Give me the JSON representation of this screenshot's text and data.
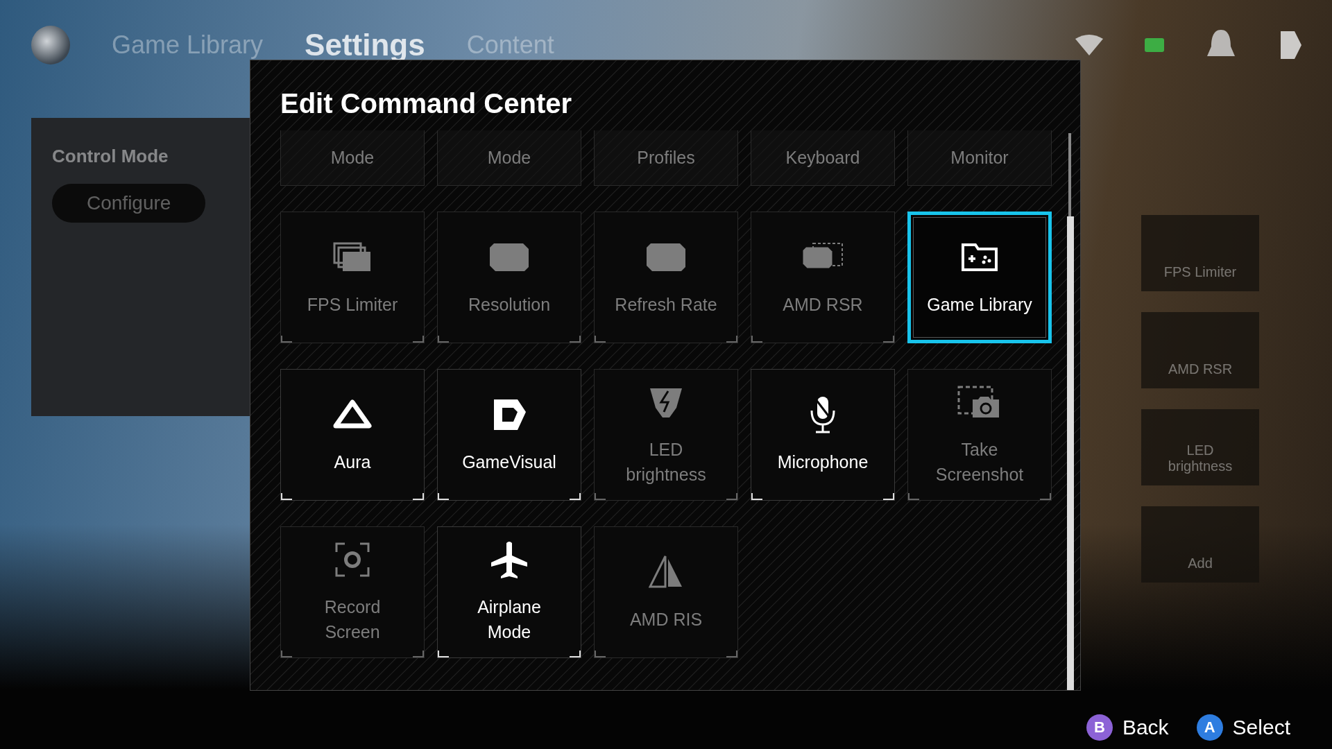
{
  "nav": {
    "tabs": [
      {
        "label": "Game Library",
        "selected": false
      },
      {
        "label": "Settings",
        "selected": true
      },
      {
        "label": "Content",
        "selected": false
      }
    ]
  },
  "background_panel": {
    "title": "Control Mode",
    "button": "Configure"
  },
  "background_tiles": [
    {
      "label": "FPS Limiter"
    },
    {
      "label": "AMD RSR"
    },
    {
      "label": "LED\nbrightness"
    },
    {
      "label": "Add"
    }
  ],
  "dialog": {
    "title": "Edit Command Center",
    "tiles": [
      {
        "label": "Mode",
        "kind": "partial",
        "active": false,
        "selected": false
      },
      {
        "label": "Mode",
        "kind": "partial",
        "active": false,
        "selected": false
      },
      {
        "label": "Profiles",
        "kind": "partial",
        "active": false,
        "selected": false
      },
      {
        "label": "Keyboard",
        "kind": "partial",
        "active": false,
        "selected": false
      },
      {
        "label": "Monitor",
        "kind": "partial",
        "active": false,
        "selected": false
      },
      {
        "label": "FPS Limiter",
        "kind": "full",
        "active": false,
        "selected": false
      },
      {
        "label": "Resolution",
        "kind": "full",
        "active": false,
        "selected": false
      },
      {
        "label": "Refresh Rate",
        "kind": "full",
        "active": false,
        "selected": false
      },
      {
        "label": "AMD RSR",
        "kind": "full",
        "active": false,
        "selected": false
      },
      {
        "label": "Game Library",
        "kind": "full",
        "active": true,
        "selected": true
      },
      {
        "label": "Aura",
        "kind": "full",
        "active": true,
        "selected": false
      },
      {
        "label": "GameVisual",
        "kind": "full",
        "active": true,
        "selected": false
      },
      {
        "label": "LED\nbrightness",
        "kind": "full",
        "active": false,
        "selected": false
      },
      {
        "label": "Microphone",
        "kind": "full",
        "active": true,
        "selected": false
      },
      {
        "label": "Take\nScreenshot",
        "kind": "full",
        "active": false,
        "selected": false
      },
      {
        "label": "Record\nScreen",
        "kind": "full",
        "active": false,
        "selected": false
      },
      {
        "label": "Airplane\nMode",
        "kind": "full",
        "active": true,
        "selected": false
      },
      {
        "label": "AMD RIS",
        "kind": "full",
        "active": false,
        "selected": false
      }
    ]
  },
  "hints": [
    {
      "key": "B",
      "label": "Back",
      "color": "#8c62d6"
    },
    {
      "key": "A",
      "label": "Select",
      "color": "#2e7de0"
    }
  ]
}
